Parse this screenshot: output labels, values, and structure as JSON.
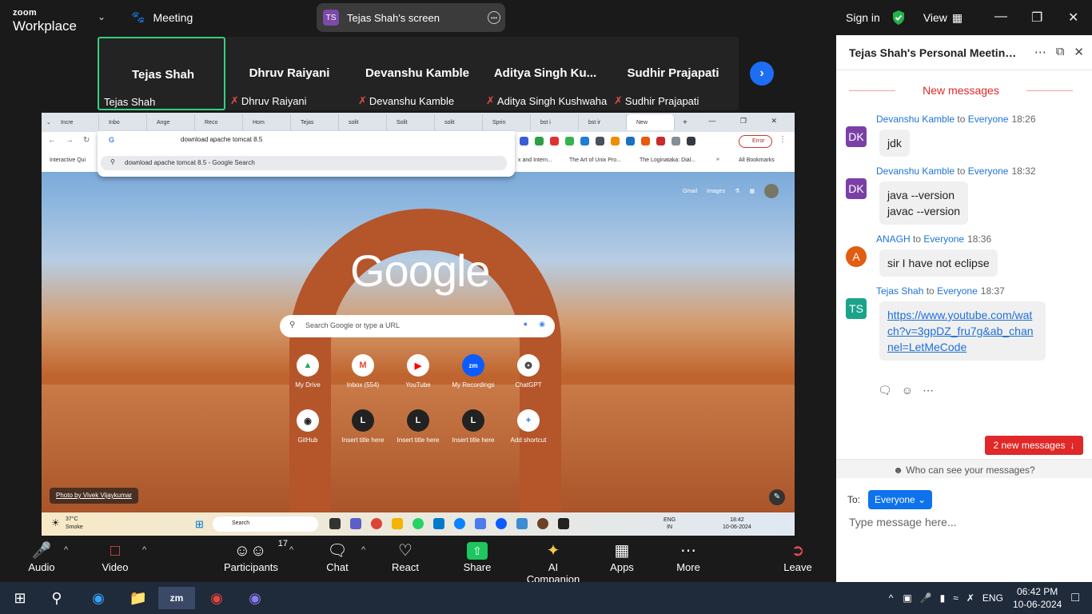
{
  "app": {
    "logo_top": "zoom",
    "logo_bottom": "Workplace",
    "meeting_label": "Meeting"
  },
  "share_pill": {
    "initials": "TS",
    "label": "Tejas Shah's screen"
  },
  "top_right": {
    "sign_in": "Sign in",
    "view": "View"
  },
  "participants": [
    {
      "big": "Tejas Shah",
      "small": "Tejas Shah",
      "muted": false
    },
    {
      "big": "Dhruv Raiyani",
      "small": "Dhruv Raiyani",
      "muted": true
    },
    {
      "big": "Devanshu Kamble",
      "small": "Devanshu Kamble",
      "muted": true
    },
    {
      "big": "Aditya Singh Ku...",
      "small": "Aditya Singh Kushwaha",
      "muted": true
    },
    {
      "big": "Sudhir Prajapati",
      "small": "Sudhir Prajapati",
      "muted": true
    }
  ],
  "screen": {
    "tabs": [
      "Incre",
      "Inbo",
      "Ange",
      "Reco",
      "Hom",
      "Tejas",
      "solit",
      "Solit",
      "solit",
      "Sprin",
      "bst i",
      "bst ir",
      "New"
    ],
    "omnibox": "download apache tomcat 8.5",
    "suggestion": "download apache tomcat 8.5 - Google Search",
    "bookmarks": [
      "Interactive Qui",
      "x and Intern...",
      "The Art of Unix Pro...",
      "The Loginataka: Dial..."
    ],
    "all_bookmarks": "All Bookmarks",
    "error": "Error",
    "gmail": "Gmail",
    "images": "Images",
    "google": "Google",
    "search_placeholder": "Search Google or type a URL",
    "shortcuts": [
      {
        "label": "My Drive",
        "glyph": "▲"
      },
      {
        "label": "Inbox (554)",
        "glyph": "M"
      },
      {
        "label": "YouTube",
        "glyph": "▶"
      },
      {
        "label": "My Recordings",
        "glyph": "zm"
      },
      {
        "label": "ChatGPT",
        "glyph": "❂"
      },
      {
        "label": "GitHub",
        "glyph": "◉"
      },
      {
        "label": "Insert title here",
        "glyph": "L"
      },
      {
        "label": "Insert title here",
        "glyph": "L"
      },
      {
        "label": "Insert title here",
        "glyph": "L"
      },
      {
        "label": "Add shortcut",
        "glyph": "+"
      }
    ],
    "photo_credit": "Photo by Vivek Vijaykumar",
    "weather_temp": "37°C",
    "weather_desc": "Smoke",
    "task_search": "Search",
    "inner_lang": "ENG",
    "inner_region": "IN",
    "inner_time": "18:42",
    "inner_date": "10-06-2024"
  },
  "panel": {
    "title": "Tejas Shah's Personal Meeting R...",
    "new_messages": "New messages",
    "messages": [
      {
        "initials": "DK",
        "color": "#7b3fa6",
        "sender": "Devanshu Kamble",
        "to": "to",
        "audience": "Everyone",
        "time": "18:26",
        "lines": [
          "jdk"
        ]
      },
      {
        "initials": "DK",
        "color": "#7b3fa6",
        "sender": "Devanshu Kamble",
        "to": "to",
        "audience": "Everyone",
        "time": "18:32",
        "lines": [
          "java --version",
          "javac --version"
        ]
      },
      {
        "initials": "A",
        "color": "#e25c12",
        "sender": "ANAGH",
        "to": "to",
        "audience": "Everyone",
        "time": "18:36",
        "lines": [
          "sir I have not eclipse"
        ]
      },
      {
        "initials": "TS",
        "color": "#1aa38b",
        "sender": "Tejas Shah",
        "to": "to",
        "audience": "Everyone",
        "time": "18:37",
        "link": "https://www.youtube.com/watch?v=3gpDZ_fru7g&ab_channel=LetMeCode"
      }
    ],
    "new_button": "2 new messages",
    "who_can_see": "Who can see your messages?",
    "to_label": "To:",
    "everyone_btn": "Everyone",
    "type_placeholder": "Type message here..."
  },
  "toolbar": {
    "audio": "Audio",
    "video": "Video",
    "participants": "Participants",
    "participants_count": "17",
    "chat": "Chat",
    "react": "React",
    "share": "Share",
    "ai": "AI Companion",
    "apps": "Apps",
    "more": "More",
    "leave": "Leave"
  },
  "taskbar": {
    "lang": "ENG",
    "time": "06:42 PM",
    "date": "10-06-2024"
  },
  "colors": {
    "accent": "#0e72ed",
    "active_border": "#35d07f",
    "alert": "#e02828",
    "share": "#1ec65f"
  }
}
